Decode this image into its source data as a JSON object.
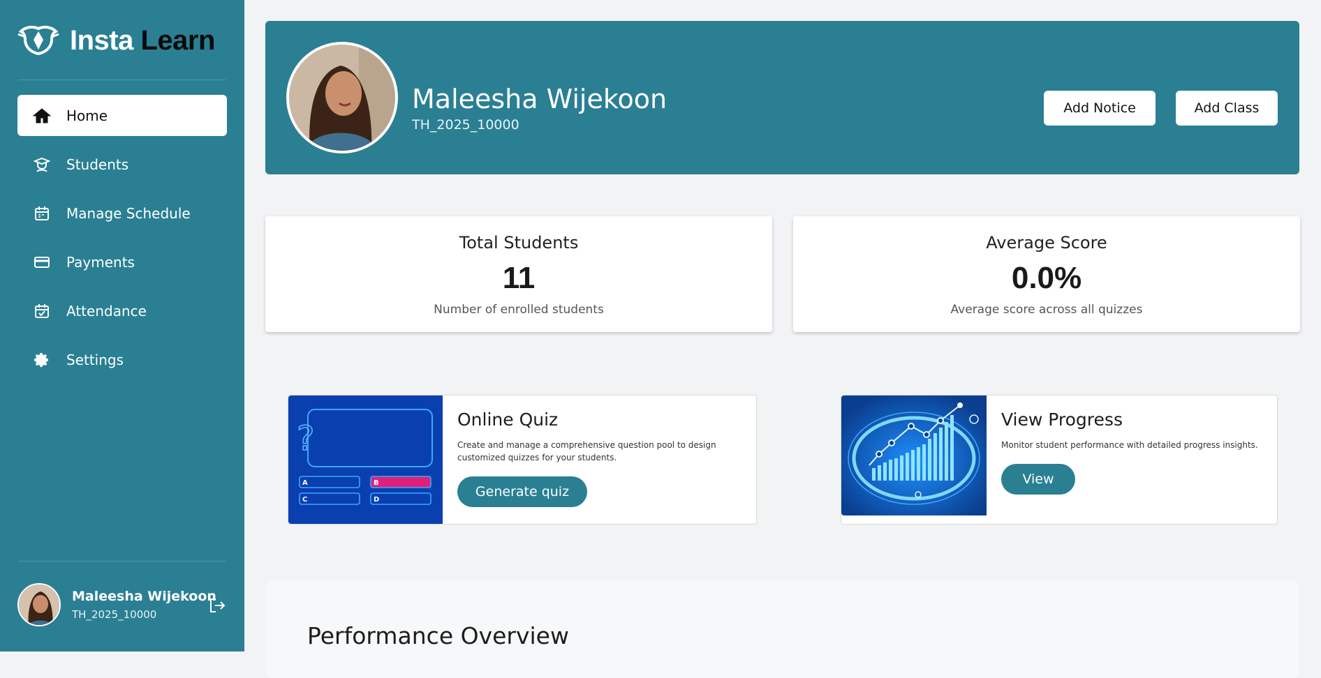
{
  "app": {
    "logo_word1": "Insta",
    "logo_word2": "Learn"
  },
  "sidebar": {
    "items": [
      {
        "label": "Home",
        "icon": "home-icon",
        "active": true
      },
      {
        "label": "Students",
        "icon": "student-icon",
        "active": false
      },
      {
        "label": "Manage Schedule",
        "icon": "calendar-icon",
        "active": false
      },
      {
        "label": "Payments",
        "icon": "credit-card-icon",
        "active": false
      },
      {
        "label": "Attendance",
        "icon": "calendar-check-icon",
        "active": false
      },
      {
        "label": "Settings",
        "icon": "gear-icon",
        "active": false
      }
    ],
    "user": {
      "name": "Maleesha Wijekoon",
      "id": "TH_2025_10000"
    }
  },
  "header": {
    "name": "Maleesha Wijekoon",
    "id": "TH_2025_10000",
    "add_notice_label": "Add Notice",
    "add_class_label": "Add Class"
  },
  "stats": [
    {
      "title": "Total Students",
      "value": "11",
      "subtitle": "Number of enrolled students"
    },
    {
      "title": "Average Score",
      "value": "0.0%",
      "subtitle": "Average score across all quizzes"
    }
  ],
  "features": {
    "quiz": {
      "title": "Online Quiz",
      "description": "Create and manage a comprehensive question pool to design customized quizzes for your students.",
      "button": "Generate quiz",
      "options": [
        "A",
        "B",
        "C",
        "D"
      ]
    },
    "progress": {
      "title": "View Progress",
      "description": "Monitor student performance with detailed progress insights.",
      "button": "View"
    }
  },
  "performance": {
    "title": "Performance Overview"
  },
  "colors": {
    "primary": "#2a7f93",
    "background": "#f2f3f5",
    "quiz_highlight": "#e0207a"
  }
}
